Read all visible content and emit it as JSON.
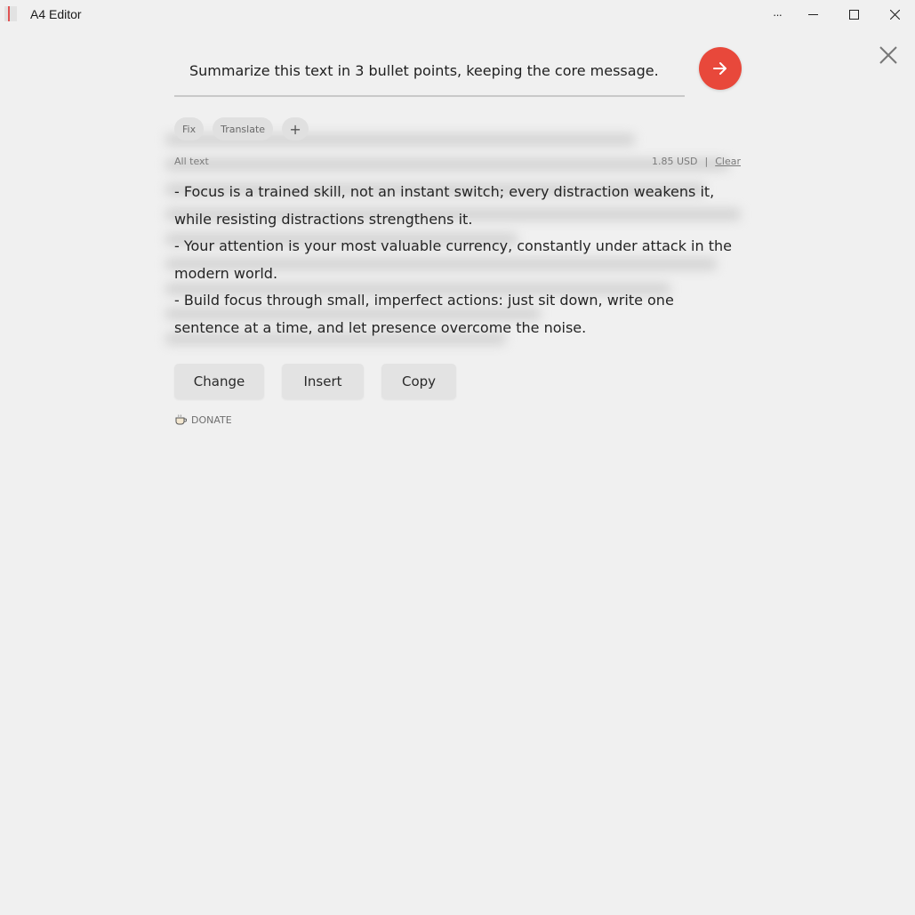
{
  "window": {
    "title": "A4 Editor",
    "more_glyph": "···"
  },
  "prompt": {
    "value": "Summarize this text in 3 bullet points, keeping the core message."
  },
  "chips": [
    {
      "label": "Fix"
    },
    {
      "label": "Translate"
    },
    {
      "label": "+"
    }
  ],
  "meta": {
    "scope": "All text",
    "cost": "1.85 USD",
    "separator": "|",
    "clear_label": "Clear"
  },
  "output": {
    "bullets": [
      "- Focus is a trained skill, not an instant switch; every distraction weakens it, while resisting distractions strengthens it.",
      "- Your attention is your most valuable currency, constantly under attack in the modern world.",
      "- Build focus through small, imperfect actions: just sit down, write one sentence at a time, and let presence overcome the noise."
    ]
  },
  "actions": {
    "change": "Change",
    "insert": "Insert",
    "copy": "Copy"
  },
  "donate": {
    "label": "DONATE"
  },
  "colors": {
    "accent": "#e8483b",
    "background": "#f0f0f0"
  }
}
